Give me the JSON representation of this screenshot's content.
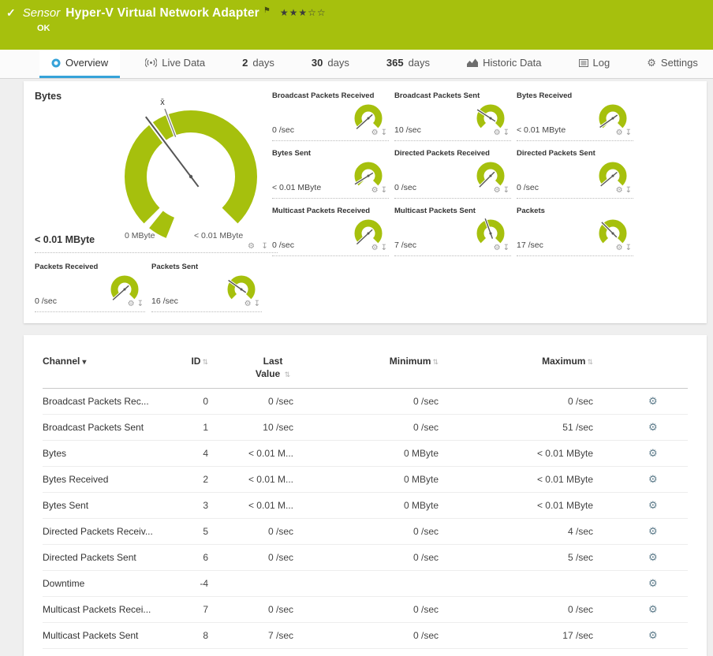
{
  "icons": {
    "gear": "⚙",
    "pin": "↧",
    "sort": "⇅",
    "sort_desc": "▾",
    "check": "✓",
    "flag": "⚑",
    "star_filled": "★",
    "star_empty": "☆"
  },
  "colors": {
    "brand_green": "#a6c00d",
    "accent_blue": "#36a3d9",
    "needle": "#555555",
    "page_bg": "#efefef"
  },
  "header": {
    "kind": "Sensor",
    "title": "Hyper-V Virtual Network Adapter",
    "status": "OK",
    "rating_filled": 3,
    "rating_total": 5
  },
  "tabs": [
    {
      "label": "Overview",
      "icon": "overview-icon",
      "active": true
    },
    {
      "label": "Live Data",
      "icon": "live-data-icon"
    },
    {
      "num": "2",
      "label": "days"
    },
    {
      "num": "30",
      "label": "days"
    },
    {
      "num": "365",
      "label": "days"
    },
    {
      "label": "Historic Data",
      "icon": "historic-data-icon"
    },
    {
      "label": "Log",
      "icon": "log-icon"
    },
    {
      "label": "Settings",
      "icon": "settings-icon"
    }
  ],
  "gauges": {
    "main": {
      "label": "Bytes",
      "value": "< 0.01 MByte",
      "scale_min": "0 MByte",
      "scale_max": "< 0.01 MByte",
      "mean_marker": "x̄",
      "needle_deg": 233
    },
    "small": [
      {
        "label": "Broadcast Packets Received",
        "value": "0 /sec",
        "needle_deg": 138
      },
      {
        "label": "Broadcast Packets Sent",
        "value": "10 /sec",
        "needle_deg": 213
      },
      {
        "label": "Bytes Received",
        "value": "< 0.01 MByte",
        "needle_deg": 145
      },
      {
        "label": "Bytes Sent",
        "value": "< 0.01 MByte",
        "needle_deg": 148
      },
      {
        "label": "Directed Packets Received",
        "value": "0 /sec",
        "needle_deg": 135
      },
      {
        "label": "Directed Packets Sent",
        "value": "0 /sec",
        "needle_deg": 140
      },
      {
        "label": "Multicast Packets Received",
        "value": "0 /sec",
        "needle_deg": 137
      },
      {
        "label": "Multicast Packets Sent",
        "value": "7 /sec",
        "needle_deg": 250
      },
      {
        "label": "Packets",
        "value": "17 /sec",
        "needle_deg": 225
      },
      {
        "label": "Packets Received",
        "value": "0 /sec",
        "needle_deg": 138
      },
      {
        "label": "Packets Sent",
        "value": "16 /sec",
        "needle_deg": 215
      }
    ]
  },
  "table": {
    "columns": [
      {
        "label": "Channel",
        "sort": "desc"
      },
      {
        "label": "ID",
        "sort": "both"
      },
      {
        "label": "Last Value",
        "sort": "both",
        "two_line": true
      },
      {
        "label": "Minimum",
        "sort": "both"
      },
      {
        "label": "Maximum",
        "sort": "both"
      }
    ],
    "rows": [
      {
        "channel": "Broadcast Packets Rec...",
        "id": "0",
        "last": "0 /sec",
        "min": "0 /sec",
        "max": "0 /sec"
      },
      {
        "channel": "Broadcast Packets Sent",
        "id": "1",
        "last": "10 /sec",
        "min": "0 /sec",
        "max": "51 /sec"
      },
      {
        "channel": "Bytes",
        "id": "4",
        "last": "< 0.01 M...",
        "min": "0 MByte",
        "max": "< 0.01 MByte"
      },
      {
        "channel": "Bytes Received",
        "id": "2",
        "last": "< 0.01 M...",
        "min": "0 MByte",
        "max": "< 0.01 MByte"
      },
      {
        "channel": "Bytes Sent",
        "id": "3",
        "last": "< 0.01 M...",
        "min": "0 MByte",
        "max": "< 0.01 MByte"
      },
      {
        "channel": "Directed Packets Receiv...",
        "id": "5",
        "last": "0 /sec",
        "min": "0 /sec",
        "max": "4 /sec"
      },
      {
        "channel": "Directed Packets Sent",
        "id": "6",
        "last": "0 /sec",
        "min": "0 /sec",
        "max": "5 /sec"
      },
      {
        "channel": "Downtime",
        "id": "-4",
        "last": "",
        "min": "",
        "max": ""
      },
      {
        "channel": "Multicast Packets Recei...",
        "id": "7",
        "last": "0 /sec",
        "min": "0 /sec",
        "max": "0 /sec"
      },
      {
        "channel": "Multicast Packets Sent",
        "id": "8",
        "last": "7 /sec",
        "min": "0 /sec",
        "max": "17 /sec"
      }
    ]
  }
}
